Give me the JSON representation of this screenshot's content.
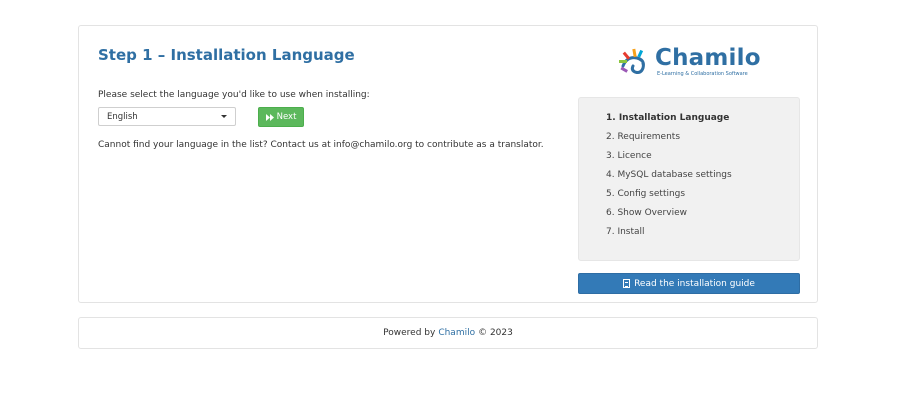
{
  "main": {
    "title": "Step 1 – Installation Language",
    "prompt": "Please select the language you'd like to use when installing:",
    "language_select": {
      "selected": "English"
    },
    "next_button": {
      "label": "Next",
      "icon": "fast-forward-icon"
    },
    "help_text": "Cannot find your language in the list? Contact us at info@chamilo.org to contribute as a translator."
  },
  "logo": {
    "name": "Chamilo",
    "tagline": "E-Learning & Collaboration Software"
  },
  "steps": [
    {
      "label": "1. Installation Language",
      "active": true
    },
    {
      "label": "2. Requirements",
      "active": false
    },
    {
      "label": "3. Licence",
      "active": false
    },
    {
      "label": "4. MySQL database settings",
      "active": false
    },
    {
      "label": "5. Config settings",
      "active": false
    },
    {
      "label": "6. Show Overview",
      "active": false
    },
    {
      "label": "7. Install",
      "active": false
    }
  ],
  "guide_button": {
    "label": "Read the installation guide",
    "icon": "document-icon"
  },
  "footer": {
    "prefix": "Powered by",
    "link": "Chamilo",
    "suffix": "© 2023"
  },
  "colors": {
    "primary": "#337ab7",
    "title_blue": "#2f6fa3",
    "success": "#5cb85c",
    "steps_bg": "#f1f1f1"
  }
}
